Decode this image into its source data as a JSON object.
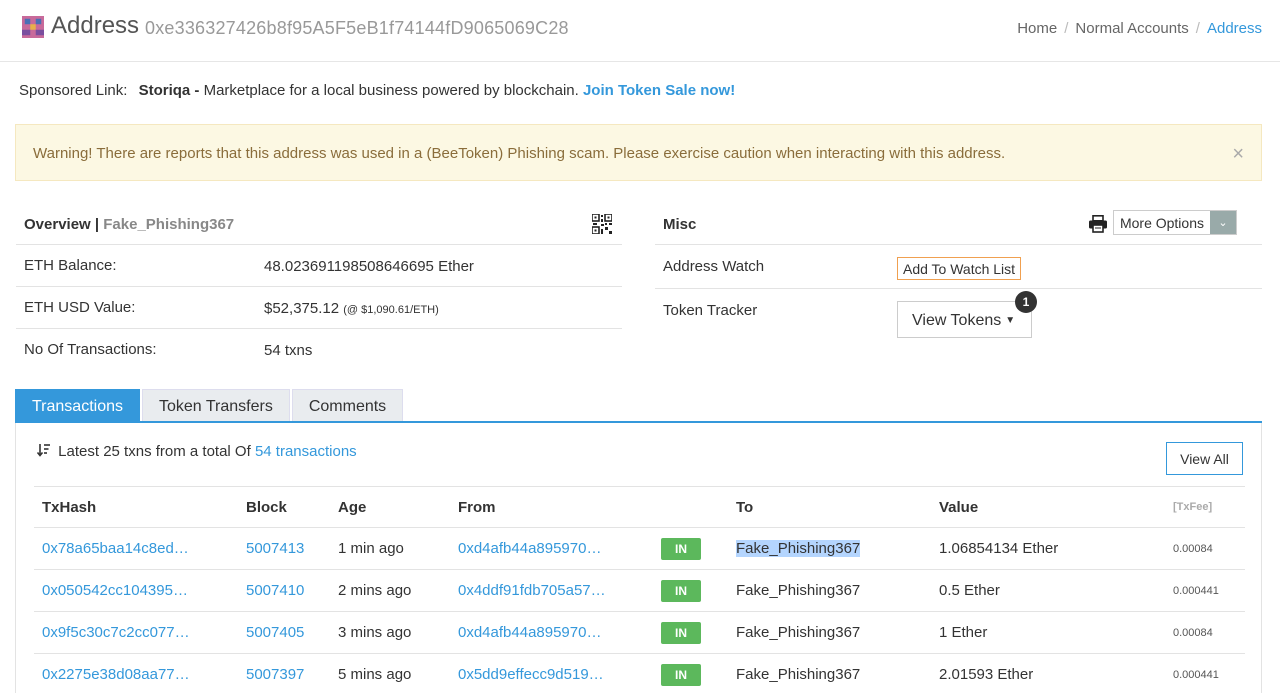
{
  "header": {
    "title": "Address",
    "address": "0xe336327426b8f95A5F5eB1f74144fD9065069C28",
    "breadcrumb": [
      "Home",
      "Normal Accounts",
      "Address"
    ]
  },
  "sponsor": {
    "prefix": "Sponsored Link:",
    "name": "Storiqa -",
    "text": "Marketplace for a local business powered by blockchain.",
    "cta": "Join Token Sale now!"
  },
  "warning": {
    "message": "Warning! There are reports that this address was used in a (BeeToken) Phishing scam. Please exercise caution when interacting with this address.",
    "close": "×"
  },
  "overview": {
    "title": "Overview |",
    "tag": "Fake_Phishing367",
    "rows": [
      {
        "label": "ETH Balance:",
        "value": "48.023691198508646695 Ether"
      },
      {
        "label": "ETH USD Value:",
        "value": "$52,375.12",
        "note": "(@ $1,090.61/ETH)"
      },
      {
        "label": "No Of Transactions:",
        "value": "54 txns"
      }
    ]
  },
  "misc": {
    "title": "Misc",
    "more_options": "More Options",
    "watch_label": "Address Watch",
    "watch_button": "Add To Watch List",
    "tracker_label": "Token Tracker",
    "view_tokens": "View Tokens",
    "token_count": "1"
  },
  "tabs": [
    "Transactions",
    "Token Transfers",
    "Comments"
  ],
  "transactions": {
    "summary_prefix": "Latest 25 txns from a total Of",
    "summary_link": "54 transactions",
    "view_all": "View All",
    "columns": [
      "TxHash",
      "Block",
      "Age",
      "From",
      "",
      "To",
      "Value",
      "[TxFee]"
    ],
    "rows": [
      {
        "hash": "0x78a65baa14c8ed…",
        "block": "5007413",
        "age": "1 min ago",
        "from": "0xd4afb44a895970…",
        "dir": "IN",
        "to": "Fake_Phishing367",
        "value": "1.06854134 Ether",
        "fee": "0.00084"
      },
      {
        "hash": "0x050542cc104395…",
        "block": "5007410",
        "age": "2 mins ago",
        "from": "0x4ddf91fdb705a57…",
        "dir": "IN",
        "to": "Fake_Phishing367",
        "value": "0.5 Ether",
        "fee": "0.000441"
      },
      {
        "hash": "0x9f5c30c7c2cc077…",
        "block": "5007405",
        "age": "3 mins ago",
        "from": "0xd4afb44a895970…",
        "dir": "IN",
        "to": "Fake_Phishing367",
        "value": "1 Ether",
        "fee": "0.00084"
      },
      {
        "hash": "0x2275e38d08aa77…",
        "block": "5007397",
        "age": "5 mins ago",
        "from": "0x5dd9effecc9d519…",
        "dir": "IN",
        "to": "Fake_Phishing367",
        "value": "2.01593 Ether",
        "fee": "0.000441"
      }
    ]
  }
}
